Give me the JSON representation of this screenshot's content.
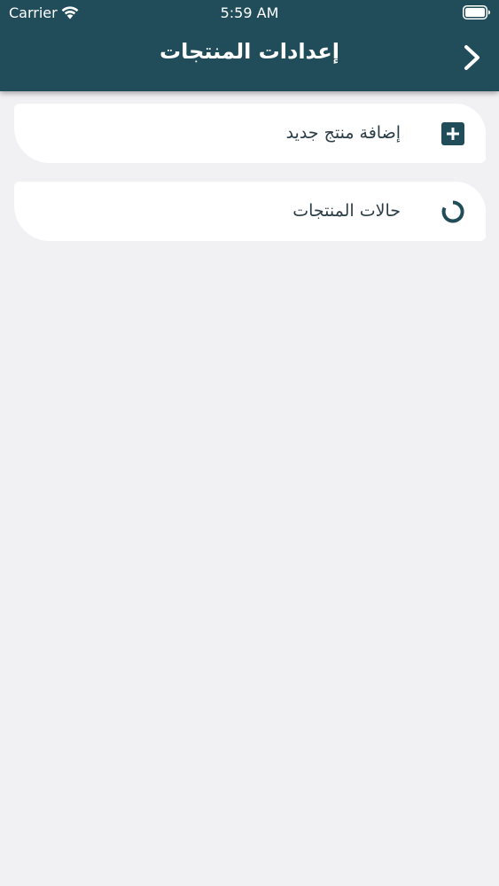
{
  "status_bar": {
    "carrier": "Carrier",
    "time": "5:59 AM",
    "wifi_icon": "wifi-icon",
    "battery_icon": "battery-icon"
  },
  "header": {
    "title": "إعدادات المنتجات",
    "back_icon": "chevron-right-icon",
    "background_color": "#214d5b"
  },
  "menu": {
    "items": [
      {
        "label": "إضافة منتج جديد",
        "icon": "plus-square-icon"
      },
      {
        "label": "حالات المنتجات",
        "icon": "circle-status-icon"
      }
    ]
  },
  "colors": {
    "page_background": "#f1f0f2",
    "card_background": "#ffffff",
    "icon_color": "#214d5b",
    "text_color": "#2b3d47"
  }
}
